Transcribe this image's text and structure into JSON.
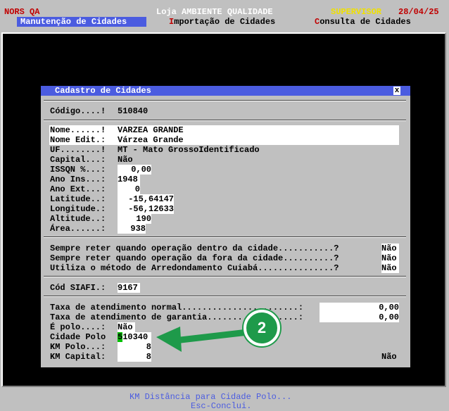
{
  "topbar": {
    "brand": "NORS QA",
    "store": "Loja AMBIENTE QUALIDADE",
    "role": "SUPERVISOR",
    "date": "28/04/25",
    "menu": [
      {
        "label": "Manutenção de Cidades"
      },
      {
        "hotkey": "I",
        "rest": "mportação de Cidades"
      },
      {
        "hotkey": "C",
        "rest": "onsulta de Cidades"
      }
    ]
  },
  "dialog": {
    "title": "Cadastro de Cidades",
    "close": "x",
    "codigo_label": "Código....!",
    "codigo_value": "510840",
    "nome_label": "Nome......!",
    "nome_value": "VARZEA GRANDE",
    "nome_edit_label": "Nome Edit.:",
    "nome_edit_value": "Várzea Grande",
    "uf_label": "UF........!",
    "uf_value": "MT - Mato GrossoIdentificado",
    "capital_label": "Capital...:",
    "capital_value": "Não",
    "isson_label": "ISSQN %...:",
    "isson_value": "0,00",
    "ano_ins_label": "Ano Ins...:",
    "ano_ins_value": "1948",
    "ano_ext_label": "Ano Ext...:",
    "ano_ext_value": "0",
    "latitude_label": "Latitude..:",
    "latitude_value": "-15,64147",
    "longitude_label": "Longitude.:",
    "longitude_value": "-56,12633",
    "altitude_label": "Altitude..:",
    "altitude_value": "190",
    "area_label": "Área......:",
    "area_value": "938",
    "reter_dentro_label": "Sempre reter quando operação dentro da cidade...........?",
    "reter_dentro_value": "Não",
    "reter_fora_label": "Sempre reter quando operação da fora da cidade..........?",
    "reter_fora_value": "Não",
    "arred_label": "Utiliza o método de Arredondamento Cuiabá...............?",
    "arred_value": "Não",
    "siafi_label": "Cód SIAFI.:",
    "siafi_value": "9167",
    "taxa_normal_label": "Taxa de atendimento normal.......................:",
    "taxa_normal_value": "0,00",
    "taxa_garantia_label": "Taxa de atendimento de garantia..................:",
    "taxa_garantia_value": "0,00",
    "e_polo_label": "É polo....:",
    "e_polo_value": "Não",
    "cidade_polo_label": "Cidade Polo",
    "cidade_polo_cursor": "5",
    "cidade_polo_rest": "10340",
    "km_polo_label": "KM Polo...:",
    "km_polo_value": "8",
    "km_capital_label": "KM Capital:",
    "km_capital_value": "8",
    "km_capital_flag": "Não"
  },
  "annotation": {
    "badge": "2",
    "color": "#1e9a4a"
  },
  "footer": {
    "line1": "KM Distância para Cidade Polo...",
    "line2": "Esc-Conclui."
  }
}
